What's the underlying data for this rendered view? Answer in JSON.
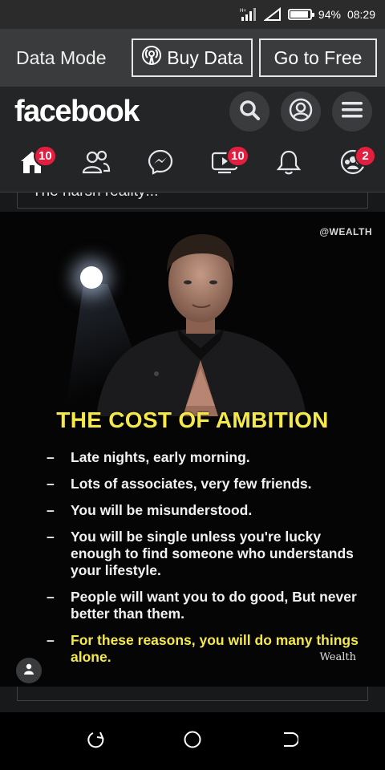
{
  "status_bar": {
    "battery": "94%",
    "battery_level": 0.94,
    "time": "08:29"
  },
  "data_mode": {
    "title": "Data Mode",
    "buy_label": "Buy Data",
    "free_label": "Go to Free"
  },
  "header": {
    "logo": "facebook"
  },
  "nav": {
    "home_badge": "10",
    "watch_badge": "10",
    "groups_badge": "2"
  },
  "feed": {
    "caption": "The harsh reality!!!",
    "image": {
      "watermark": "@WEALTH",
      "title": "THE COST OF AMBITION",
      "points": [
        "Late nights, early morning.",
        "Lots of associates, very few friends.",
        "You will be misunderstood.",
        "You will be single unless you're lucky enough to find someone who understands your lifestyle.",
        "People will want you to do good, But never better than them.",
        "For these reasons, you will do many things alone."
      ],
      "brand": "Wealth"
    }
  },
  "colors": {
    "accent_yellow": "#f5e84a",
    "badge_red": "#e41e3f",
    "header_bg": "#242526"
  }
}
